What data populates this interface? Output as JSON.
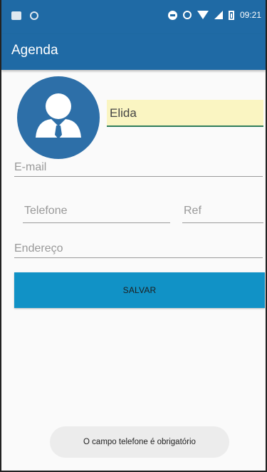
{
  "status_bar": {
    "time": "09:21",
    "icons": [
      "image-icon",
      "circle-icon",
      "do-not-disturb-icon",
      "alarm-icon",
      "wifi-icon",
      "signal-icon",
      "battery-icon"
    ]
  },
  "app_bar": {
    "title": "Agenda"
  },
  "form": {
    "name_value": "Elida",
    "email_placeholder": "E-mail",
    "telefone_placeholder": "Telefone",
    "ref_placeholder": "Ref",
    "endereco_placeholder": "Endereço",
    "save_label": "SALVAR"
  },
  "toast": {
    "message": "O campo telefone é obrigatório"
  },
  "colors": {
    "primary": "#1f6aa5",
    "button": "#1192c6",
    "name_highlight": "#faf5c2",
    "focus_underline": "#2e7d5b"
  }
}
